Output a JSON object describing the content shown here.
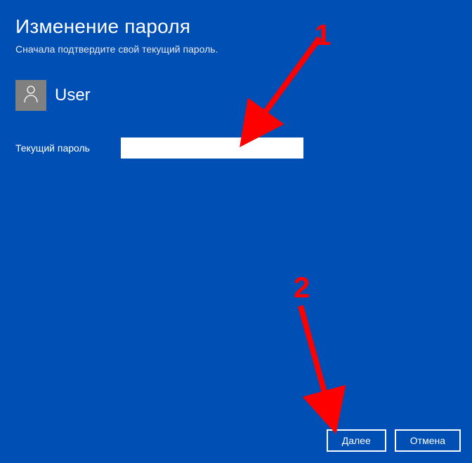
{
  "header": {
    "title": "Изменение пароля",
    "subtitle": "Сначала подтвердите свой текущий пароль."
  },
  "user": {
    "name": "User"
  },
  "form": {
    "current_password_label": "Текущий пароль",
    "current_password_value": ""
  },
  "buttons": {
    "next": "Далее",
    "cancel": "Отмена"
  },
  "annotations": {
    "label_1": "1",
    "label_2": "2"
  }
}
